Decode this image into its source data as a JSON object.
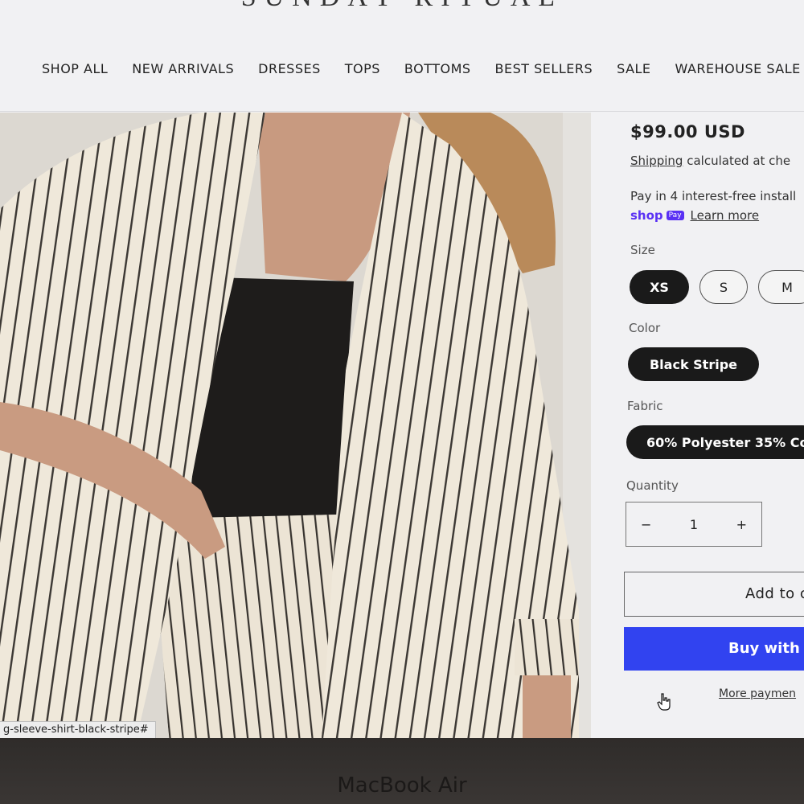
{
  "header": {
    "brand": "SUNDAY RITUAL",
    "nav": [
      "SHOP ALL",
      "NEW ARRIVALS",
      "DRESSES",
      "TOPS",
      "BOTTOMS",
      "BEST SELLERS",
      "SALE",
      "WAREHOUSE SALE"
    ]
  },
  "product": {
    "price": "$99.00 USD",
    "shipping_link": "Shipping",
    "shipping_rest": "calculated at che",
    "installments": "Pay in 4 interest-free install",
    "shop_logo": "shop",
    "shop_pay_tag": "Pay",
    "learn_more": "Learn more",
    "size_label": "Size",
    "sizes": [
      "XS",
      "S",
      "M"
    ],
    "selected_size": "XS",
    "color_label": "Color",
    "color_value": "Black Stripe",
    "fabric_label": "Fabric",
    "fabric_value": "60% Polyester 35% Co",
    "quantity_label": "Quantity",
    "quantity_minus": "−",
    "quantity_value": "1",
    "quantity_plus": "+",
    "add_to_cart": "Add to c",
    "buy_with": "Buy with S",
    "more_payment": "More paymen"
  },
  "status_url": "g-sleeve-shirt-black-stripe#",
  "device_label": "MacBook Air",
  "colors": {
    "buy_button": "#3143f0",
    "selected_pill": "#1a1a1a",
    "shop_pay": "#5a31f4"
  }
}
